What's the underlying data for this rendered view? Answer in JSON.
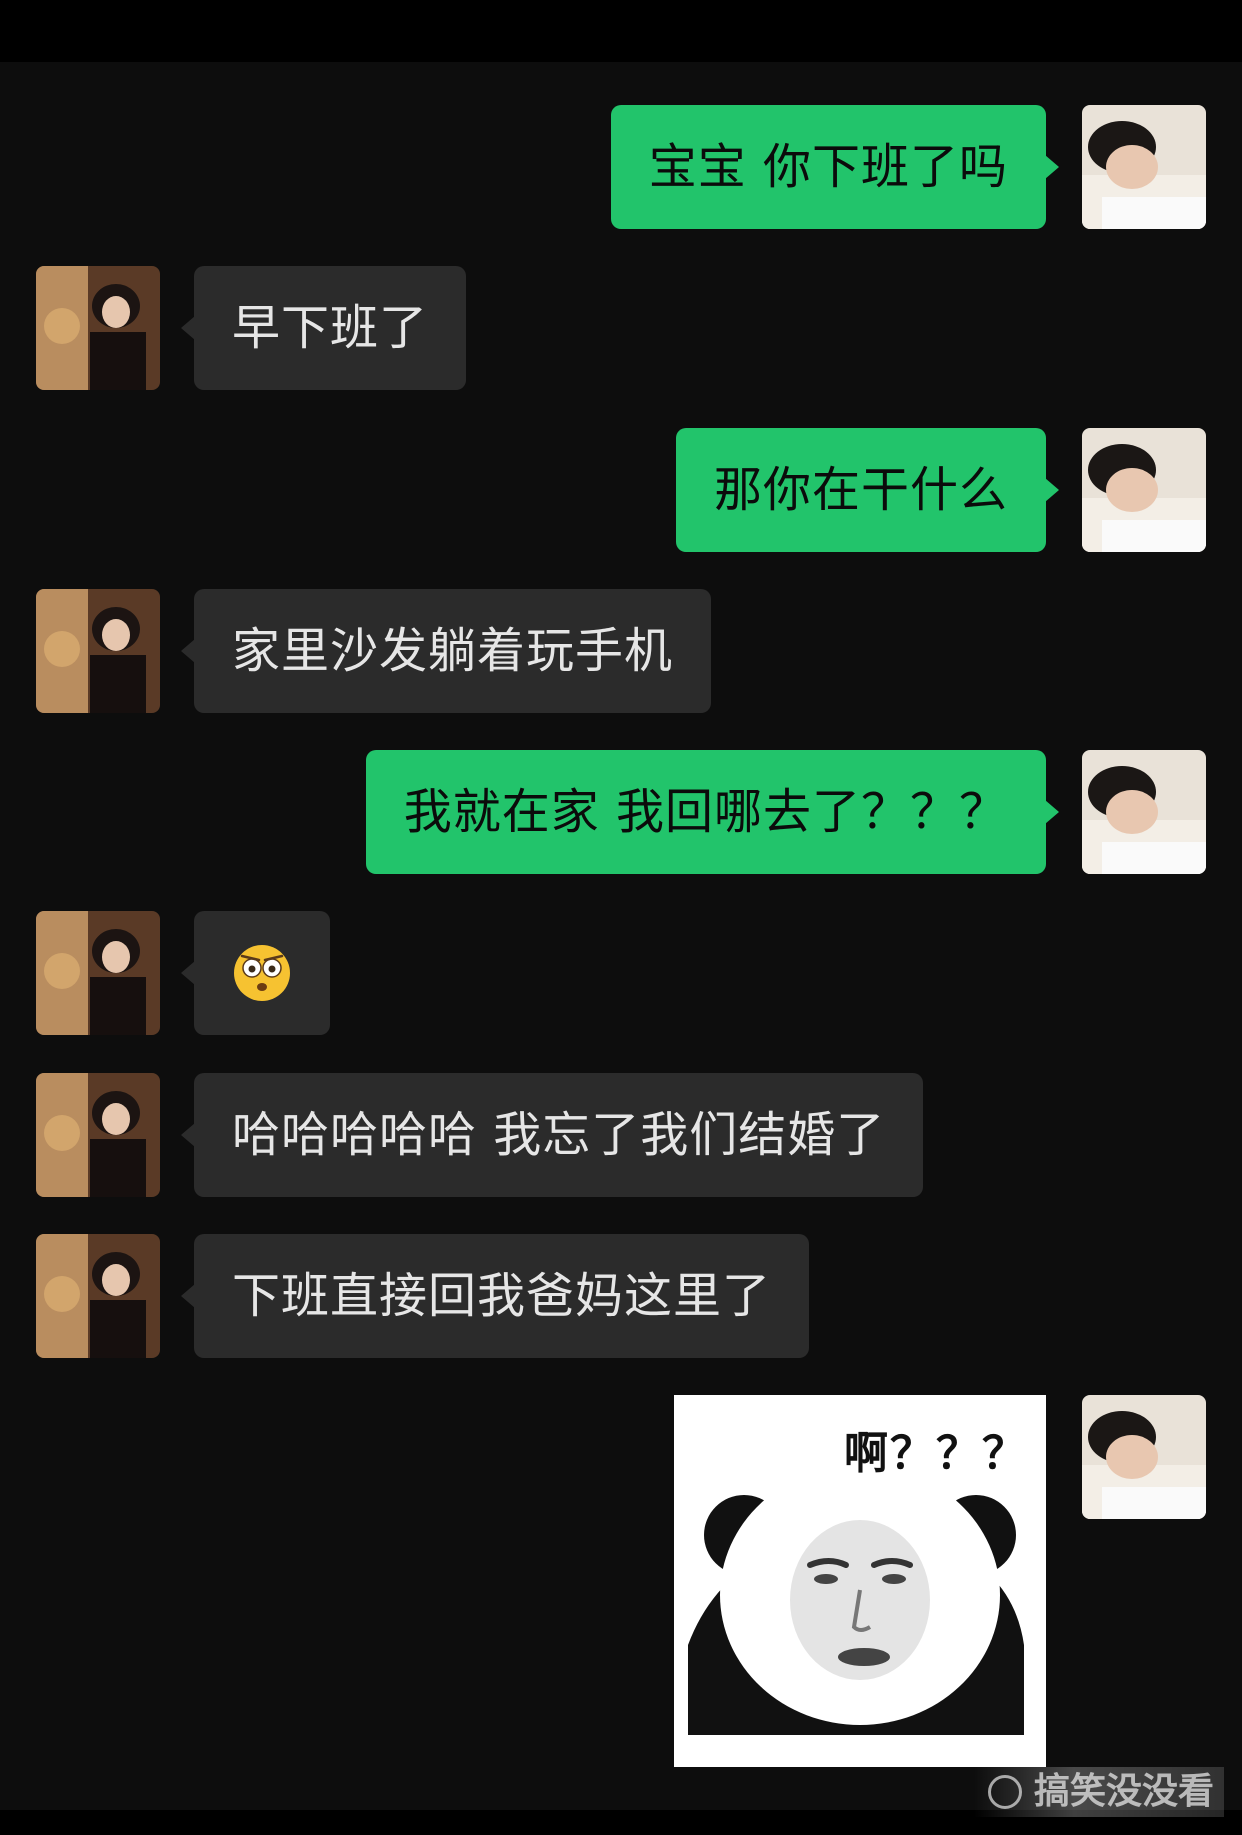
{
  "chat": {
    "messages": [
      {
        "side": "out",
        "text": "宝宝 你下班了吗"
      },
      {
        "side": "in",
        "text": "早下班了"
      },
      {
        "side": "out",
        "text": "那你在干什么"
      },
      {
        "side": "in",
        "text": "家里沙发躺着玩手机"
      },
      {
        "side": "out",
        "text": "我就在家 我回哪去了？？？"
      },
      {
        "side": "in",
        "emoji": "surprised-flushed-emoji"
      },
      {
        "side": "in",
        "text": "哈哈哈哈哈 我忘了我们结婚了"
      },
      {
        "side": "in",
        "text": "下班直接回我爸妈这里了"
      },
      {
        "side": "out",
        "sticker_caption": "啊？？？",
        "sticker": "panda-face-sticker"
      }
    ]
  },
  "colors": {
    "outgoing_bubble": "#22c46b",
    "incoming_bubble": "#2b2b2b",
    "background": "#0d0d0d"
  },
  "watermark": {
    "text": "搞笑没没看"
  }
}
